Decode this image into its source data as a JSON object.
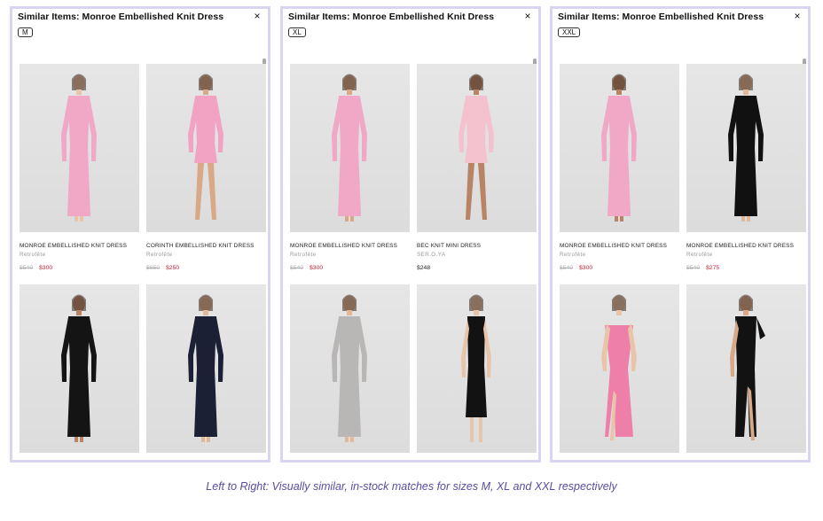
{
  "caption": "Left to Right: Visually similar, in-stock matches for sizes M, XL and XXL respectively",
  "colors": {
    "panel_border": "#d9d4ef",
    "sale_price": "#c0243a",
    "caption": "#5a4ca0"
  },
  "panels": [
    {
      "title": "Similar Items: Monroe Embellished Knit Dress",
      "size": "M",
      "close_icon": "×",
      "items": [
        {
          "name": "MONROE EMBELLISHED KNIT DRESS",
          "brand": "Retrofête",
          "price_original": "$540",
          "price_current": "$300",
          "dress_color": "#f1a8c6",
          "style": "maxi-long-sleeve"
        },
        {
          "name": "CORINTH EMBELLISHED KNIT DRESS",
          "brand": "Retrofête",
          "price_original": "$650",
          "price_current": "$250",
          "dress_color": "#f2a3c3",
          "style": "mini-long-sleeve"
        },
        {
          "name": "",
          "brand": "",
          "price_original": "",
          "price_current": "",
          "dress_color": "#141414",
          "style": "maxi-long-sleeve"
        },
        {
          "name": "",
          "brand": "",
          "price_original": "",
          "price_current": "",
          "dress_color": "#1c2035",
          "style": "maxi-long-sleeve"
        }
      ]
    },
    {
      "title": "Similar Items: Monroe Embellished Knit Dress",
      "size": "XL",
      "close_icon": "×",
      "items": [
        {
          "name": "MONROE EMBELLISHED KNIT DRESS",
          "brand": "Retrofête",
          "price_original": "$540",
          "price_current": "$300",
          "dress_color": "#f1a8c6",
          "style": "maxi-long-sleeve"
        },
        {
          "name": "BEC KNIT MINI DRESS",
          "brand": "SER.O.YA",
          "price_original": "",
          "price_current": "$248",
          "dress_color": "#f4c2cf",
          "style": "mini-long-sleeve"
        },
        {
          "name": "",
          "brand": "",
          "price_original": "",
          "price_current": "",
          "dress_color": "#b9b7b5",
          "style": "maxi-long-sleeve"
        },
        {
          "name": "",
          "brand": "",
          "price_original": "",
          "price_current": "",
          "dress_color": "#121212",
          "style": "midi-sleeveless"
        }
      ]
    },
    {
      "title": "Similar Items: Monroe Embellished Knit Dress",
      "size": "XXL",
      "close_icon": "×",
      "items": [
        {
          "name": "MONROE EMBELLISHED KNIT DRESS",
          "brand": "Retrofête",
          "price_original": "$540",
          "price_current": "$300",
          "dress_color": "#f1a8c6",
          "style": "maxi-long-sleeve"
        },
        {
          "name": "MONROE EMBELLISHED KNIT DRESS",
          "brand": "Retrofête",
          "price_original": "$540",
          "price_current": "$275",
          "dress_color": "#111111",
          "style": "maxi-long-sleeve"
        },
        {
          "name": "",
          "brand": "",
          "price_original": "",
          "price_current": "",
          "dress_color": "#ee7fa8",
          "style": "offshoulder-slit"
        },
        {
          "name": "",
          "brand": "",
          "price_original": "",
          "price_current": "",
          "dress_color": "#121212",
          "style": "oneshoulder-slit"
        }
      ]
    }
  ]
}
